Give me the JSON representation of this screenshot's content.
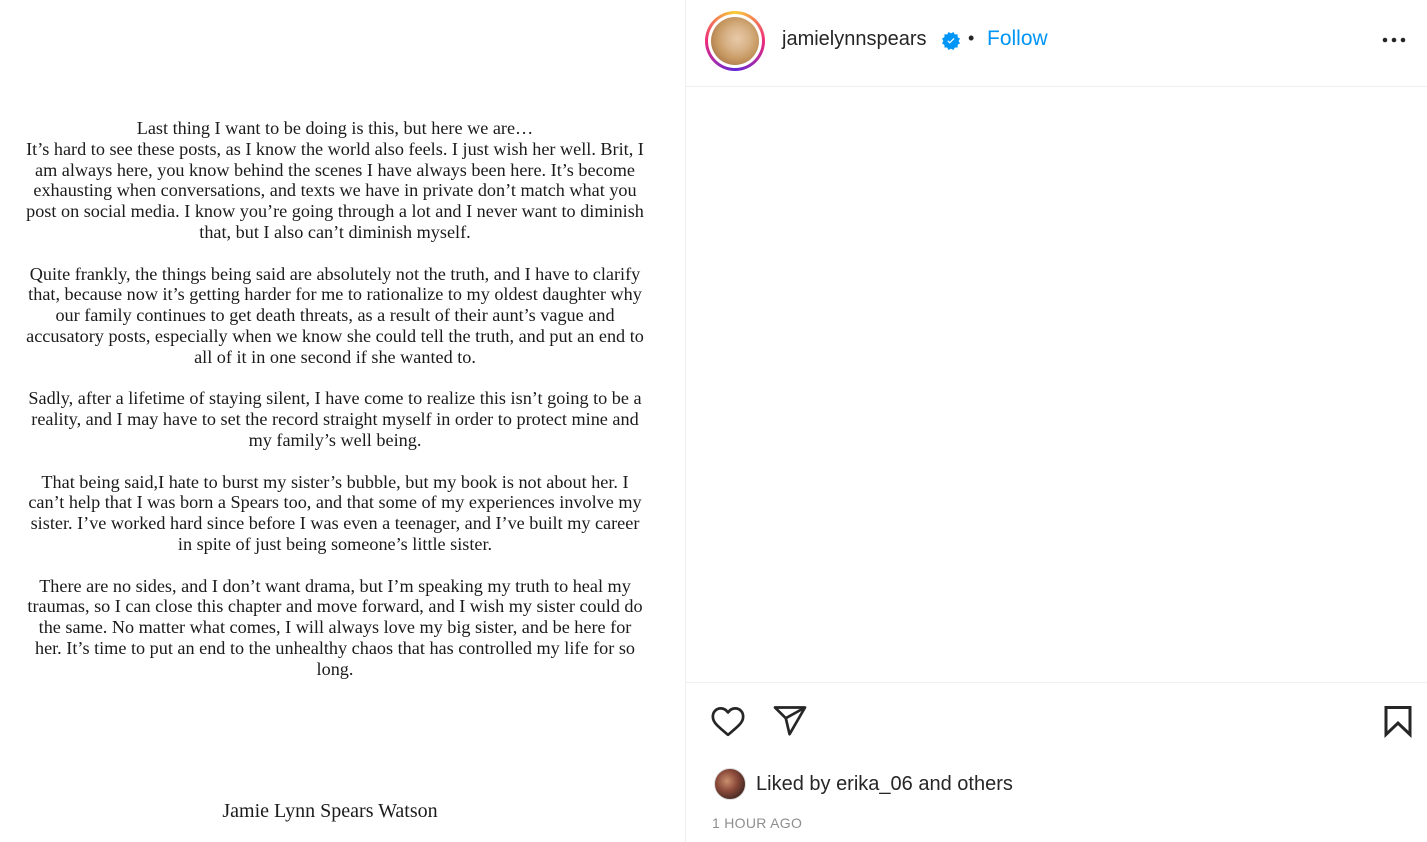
{
  "post": {
    "statement_paragraphs": [
      "Last thing I want to be doing is this, but here we are…\nIt’s hard to see these posts, as I know the world also feels. I just wish her well. Brit, I am always here, you know behind the scenes I have always been here. It’s become exhausting when conversations, and texts we have in private don’t match what you post on social media. I know you’re going through a lot and I never want to diminish that, but I also can’t diminish myself.",
      "Quite frankly, the things being said are absolutely not the truth, and I have to clarify that, because now it’s getting harder for me to rationalize to my oldest daughter why our family continues to get death threats, as a result of their aunt’s vague and accusatory posts, especially when we know she could tell the truth, and put an end to all of it in one second if she wanted to.",
      "Sadly, after a lifetime of staying silent, I have come to realize this isn’t going to be a reality,  and I may have to set the record straight myself in order to protect mine and my family’s well being.",
      "That being said,I hate to burst my sister’s bubble, but my book is not about her. I can’t help that I was born a Spears too, and that some of my experiences involve my sister. I’ve worked hard since before I was even a teenager, and I’ve built my career in spite of just being someone’s little sister.",
      "There are no sides, and I don’t want drama, but I’m speaking my truth to heal my traumas, so I can close this chapter and move forward, and I wish my sister could do the same. No matter what comes, I will always love my big sister, and be here for her. It’s time to put an end to the unhealthy chaos that has controlled my life for so long."
    ],
    "signature": "Jamie Lynn Spears Watson"
  },
  "header": {
    "username": "jamielynnspears",
    "separator": "•",
    "follow_label": "Follow",
    "verified_icon": "verified-badge-icon",
    "more_icon": "more-options-icon"
  },
  "actions": {
    "like_icon": "heart-icon",
    "share_icon": "send-icon",
    "save_icon": "bookmark-icon"
  },
  "likes": {
    "prefix": "Liked by",
    "user": "erika_06",
    "conjunction": "and",
    "others": "others"
  },
  "timestamp": "1 HOUR AGO",
  "colors": {
    "accent": "#0095f6",
    "text": "#262626",
    "muted": "#8e8e8e",
    "verified": "#0095f6"
  }
}
